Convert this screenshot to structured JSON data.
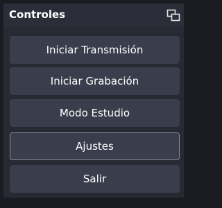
{
  "dock": {
    "title": "Controles",
    "float_icon": "float-window-icon",
    "buttons": [
      {
        "label": "Iniciar Transmisión"
      },
      {
        "label": "Iniciar Grabación"
      },
      {
        "label": "Modo Estudio"
      },
      {
        "label": "Ajustes",
        "focused": true
      },
      {
        "label": "Salir"
      }
    ]
  },
  "colors": {
    "background": "#1b1c22",
    "header": "#2b2e38",
    "panel": "#272a33",
    "button": "#3a3e4c",
    "focus_border": "#878b97",
    "text": "#ffffff"
  }
}
